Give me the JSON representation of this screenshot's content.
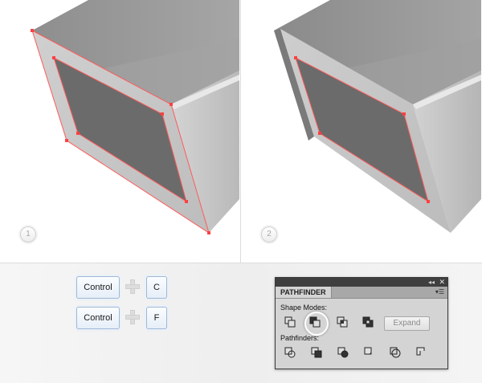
{
  "steps": [
    {
      "number": "1"
    },
    {
      "number": "2"
    }
  ],
  "shortcuts": [
    {
      "modifier": "Control",
      "key": "C"
    },
    {
      "modifier": "Control",
      "key": "F"
    }
  ],
  "pathfinder": {
    "tab_label": "PATHFINDER",
    "collapse_glyph": "◂◂",
    "close_glyph": "✕",
    "menu_glyph": "▾☰",
    "shape_modes_label": "Shape Modes:",
    "pathfinders_label": "Pathfinders:",
    "expand_label": "Expand",
    "shape_mode_icons": [
      "unite-icon",
      "minus-front-icon",
      "intersect-icon",
      "exclude-icon"
    ],
    "pathfinder_icons": [
      "divide-icon",
      "trim-icon",
      "merge-icon",
      "crop-icon",
      "outline-icon",
      "minus-back-icon"
    ],
    "highlighted_shape_mode": "minus-front-icon"
  },
  "colors": {
    "anchor_points": "#ff4040",
    "box_dark": "#6b6b6b",
    "box_mid": "#a9a9a9",
    "box_light": "#c7c7c7"
  }
}
